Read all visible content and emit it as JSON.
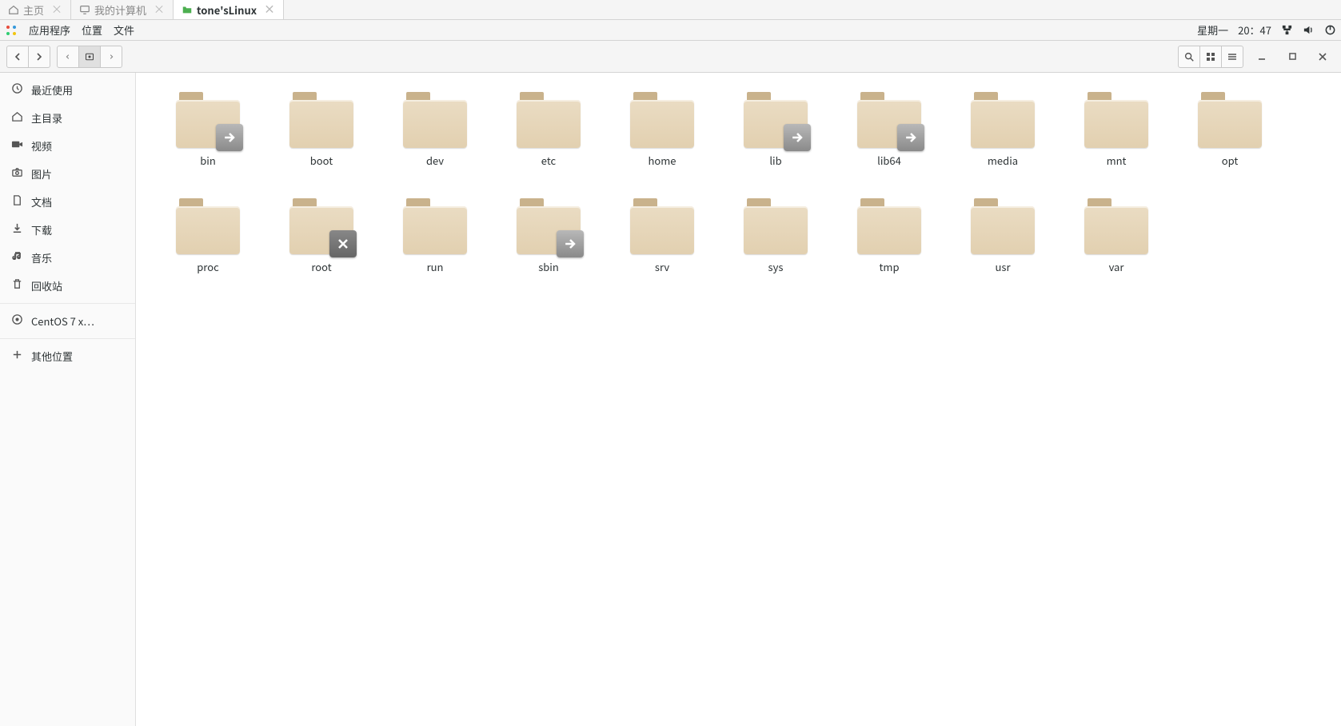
{
  "window_tabs": [
    {
      "label": "主页",
      "active": false
    },
    {
      "label": "我的计算机",
      "active": false
    },
    {
      "label": "tone'sLinux",
      "active": true
    }
  ],
  "menu": {
    "applications": "应用程序",
    "places": "位置",
    "files": "文件",
    "date": "星期一",
    "time": "20：47"
  },
  "sidebar": {
    "items": [
      {
        "label": "最近使用",
        "icon": "clock"
      },
      {
        "label": "主目录",
        "icon": "home"
      },
      {
        "label": "视频",
        "icon": "video"
      },
      {
        "label": "图片",
        "icon": "camera"
      },
      {
        "label": "文档",
        "icon": "doc"
      },
      {
        "label": "下载",
        "icon": "download"
      },
      {
        "label": "音乐",
        "icon": "music"
      },
      {
        "label": "回收站",
        "icon": "trash"
      }
    ],
    "volumes": [
      {
        "label": "CentOS 7 x…",
        "icon": "disc"
      }
    ],
    "other": {
      "label": "其他位置",
      "icon": "plus"
    }
  },
  "folders": [
    {
      "name": "bin",
      "badge": "link"
    },
    {
      "name": "boot",
      "badge": null
    },
    {
      "name": "dev",
      "badge": null
    },
    {
      "name": "etc",
      "badge": null
    },
    {
      "name": "home",
      "badge": null
    },
    {
      "name": "lib",
      "badge": "link"
    },
    {
      "name": "lib64",
      "badge": "link"
    },
    {
      "name": "media",
      "badge": null
    },
    {
      "name": "mnt",
      "badge": null
    },
    {
      "name": "opt",
      "badge": null
    },
    {
      "name": "proc",
      "badge": null
    },
    {
      "name": "root",
      "badge": "lock"
    },
    {
      "name": "run",
      "badge": null
    },
    {
      "name": "sbin",
      "badge": "link"
    },
    {
      "name": "srv",
      "badge": null
    },
    {
      "name": "sys",
      "badge": null
    },
    {
      "name": "tmp",
      "badge": null
    },
    {
      "name": "usr",
      "badge": null
    },
    {
      "name": "var",
      "badge": null
    }
  ]
}
